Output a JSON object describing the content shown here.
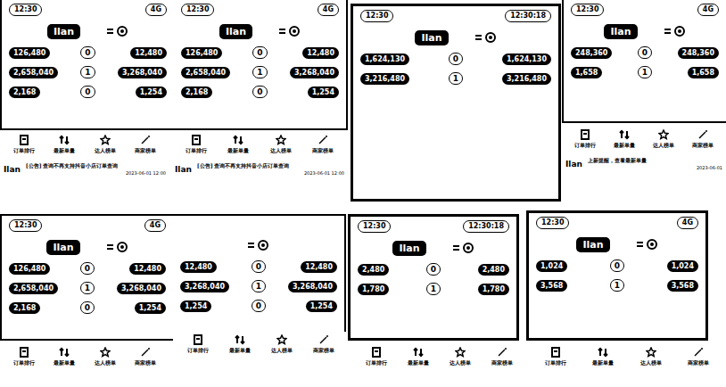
{
  "shots": [
    {
      "screens": [
        {
          "top": [
            "12:30",
            "4G"
          ],
          "brand": "Ilan",
          "stats": [
            [
              "126,480",
              "0",
              "12,480"
            ],
            [
              "2,658,040",
              "1",
              "3,268,040"
            ],
            [
              "2,168",
              "0",
              "1,254"
            ]
          ]
        },
        {
          "top": [
            "12:30",
            "4G"
          ],
          "brand": "Ilan",
          "stats": [
            [
              "126,480",
              "0",
              "12,480"
            ],
            [
              "2,658,040",
              "1",
              "3,268,040"
            ],
            [
              "2,168",
              "0",
              "1,254"
            ]
          ]
        }
      ]
    },
    {
      "screens": [
        {
          "top": [
            "12:30",
            "12:30:18"
          ],
          "brand": "Ilan",
          "stats": [
            [
              "1,624,130",
              "0",
              "1,624,130"
            ],
            [
              "3,216,480",
              "1",
              "3,216,480"
            ]
          ]
        }
      ]
    },
    {
      "screens": [
        {
          "top": [
            "12:30",
            "4G"
          ],
          "brand": "Ilan",
          "stats": [
            [
              "248,360",
              "0",
              "248,360"
            ],
            [
              "1,658",
              "1",
              "1,658"
            ]
          ]
        }
      ]
    },
    {
      "screens": [
        {
          "top": [
            "12:30",
            "4G"
          ],
          "brand": "Ilan",
          "stats": [
            [
              "126,480",
              "0",
              "12,480"
            ],
            [
              "2,658,040",
              "1",
              "3,268,040"
            ],
            [
              "2,168",
              "0",
              "1,254"
            ]
          ]
        },
        {
          "top": [
            "",
            ""
          ],
          "brand": "",
          "stats": [
            [
              "12,480",
              "0",
              "12,480"
            ],
            [
              "3,268,040",
              "1",
              "3,268,040"
            ],
            [
              "1,254",
              "0",
              "1,254"
            ]
          ]
        }
      ]
    },
    {
      "screens": [
        {
          "top": [
            "12:30",
            "12:30:18"
          ],
          "brand": "Ilan",
          "stats": [
            [
              "2,480",
              "0",
              "2,480"
            ],
            [
              "1,780",
              "1",
              "1,780"
            ]
          ]
        }
      ]
    },
    {
      "screens": [
        {
          "top": [
            "12:30",
            "4G"
          ],
          "brand": "Ilan",
          "stats": [
            [
              "1,024",
              "0",
              "1,024"
            ],
            [
              "3,568",
              "1",
              "3,568"
            ]
          ]
        }
      ]
    }
  ],
  "strips": [
    {
      "nav": [
        {
          "label": "订单排行",
          "icon": "order"
        },
        {
          "label": "最新单量",
          "icon": "sort"
        },
        {
          "label": "达人榜单",
          "icon": "star"
        },
        {
          "label": "商家榜单",
          "icon": "wand"
        }
      ],
      "notice": {
        "brand": "Ilan",
        "text": "[公告] 查询不再支持抖音小店订单查询",
        "meta": "2023-06-01 12:00"
      }
    },
    {
      "nav": [
        {
          "label": "订单排行",
          "icon": "order"
        },
        {
          "label": "最新单量",
          "icon": "sort"
        },
        {
          "label": "达人榜单",
          "icon": "star"
        },
        {
          "label": "商家榜单",
          "icon": "wand"
        }
      ],
      "notice": {
        "brand": "Ilan",
        "text": "[公告] 查询不再支持抖音小店订单查询",
        "meta": "2023-06-01 12:00"
      }
    },
    {
      "nav": [
        {
          "label": "订单排行",
          "icon": "order"
        },
        {
          "label": "最新单量",
          "icon": "sort"
        },
        {
          "label": "达人榜单",
          "icon": "star"
        },
        {
          "label": "商家榜单",
          "icon": "wand"
        }
      ],
      "notice": {
        "brand": "Ilan",
        "text": "上新提醒，查看最新单量",
        "meta": "2023-06-01"
      }
    },
    {
      "nav": [
        {
          "label": "订单排行",
          "icon": "order"
        },
        {
          "label": "最新单量",
          "icon": "sort"
        },
        {
          "label": "达人榜单",
          "icon": "star"
        },
        {
          "label": "商家榜单",
          "icon": "wand"
        }
      ],
      "notice": null
    },
    {
      "nav": [
        {
          "label": "订单排行",
          "icon": "order"
        },
        {
          "label": "最新单量",
          "icon": "sort"
        },
        {
          "label": "达人榜单",
          "icon": "star"
        },
        {
          "label": "商家榜单",
          "icon": "wand"
        }
      ],
      "notice": null
    },
    {
      "nav": [
        {
          "label": "订单排行",
          "icon": "order"
        },
        {
          "label": "最新单量",
          "icon": "sort"
        },
        {
          "label": "达人榜单",
          "icon": "star"
        },
        {
          "label": "商家榜单",
          "icon": "wand"
        }
      ],
      "notice": null
    },
    {
      "nav": [
        {
          "label": "订单排行",
          "icon": "order"
        },
        {
          "label": "最新单量",
          "icon": "sort"
        },
        {
          "label": "达人榜单",
          "icon": "star"
        },
        {
          "label": "商家榜单",
          "icon": "wand"
        }
      ],
      "notice": null
    }
  ]
}
